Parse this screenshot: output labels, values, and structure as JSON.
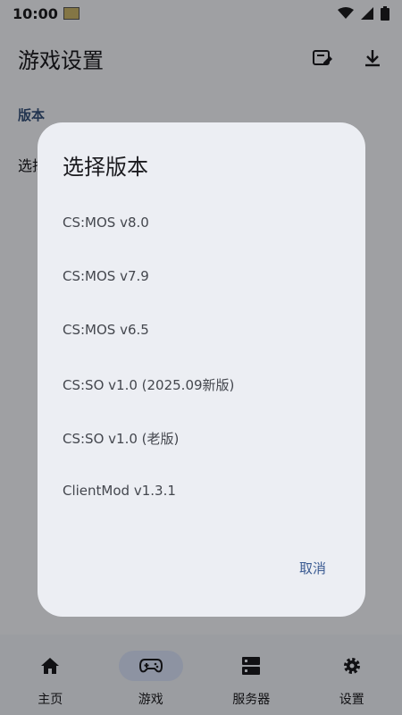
{
  "status": {
    "time": "10:00"
  },
  "app_bar": {
    "title": "游戏设置",
    "actions": [
      "edit-card-icon",
      "download-icon"
    ]
  },
  "settings": {
    "section_label": "版本",
    "pref_title_partial": "选择"
  },
  "dialog": {
    "title": "选择版本",
    "options": [
      "CS:MOS v8.0",
      "CS:MOS v7.9",
      "CS:MOS v6.5",
      "CS:SO v1.0 (2025.09新版)",
      "CS:SO v1.0 (老版)",
      "ClientMod v1.3.1"
    ],
    "cancel_label": "取消"
  },
  "bottom_nav": {
    "items": [
      {
        "label": "主页",
        "icon": "home-icon"
      },
      {
        "label": "游戏",
        "icon": "gamepad-icon",
        "active": true
      },
      {
        "label": "服务器",
        "icon": "server-icon"
      },
      {
        "label": "设置",
        "icon": "gear-icon"
      }
    ]
  },
  "colors": {
    "accent": "#3b5b92",
    "section": "#36517a",
    "active_pill": "#d6e0f6"
  }
}
